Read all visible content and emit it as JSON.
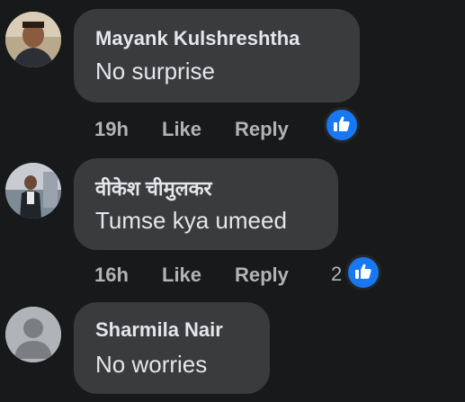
{
  "comments": [
    {
      "author": "Mayank Kulshreshtha",
      "text": "No surprise",
      "time": "19h",
      "like_label": "Like",
      "reply_label": "Reply",
      "reaction_count": "",
      "avatar": "photo-avatar"
    },
    {
      "author": "वीकेश चीमुलकर",
      "text": "Tumse kya umeed",
      "time": "16h",
      "like_label": "Like",
      "reply_label": "Reply",
      "reaction_count": "2",
      "avatar": "photo-avatar"
    },
    {
      "author": "Sharmila Nair",
      "text": "No worries",
      "avatar": "default-avatar"
    }
  ],
  "colors": {
    "background": "#18191a",
    "bubble": "#3a3b3c",
    "like_blue": "#1877f2",
    "secondary_text": "#b0b3b8"
  }
}
